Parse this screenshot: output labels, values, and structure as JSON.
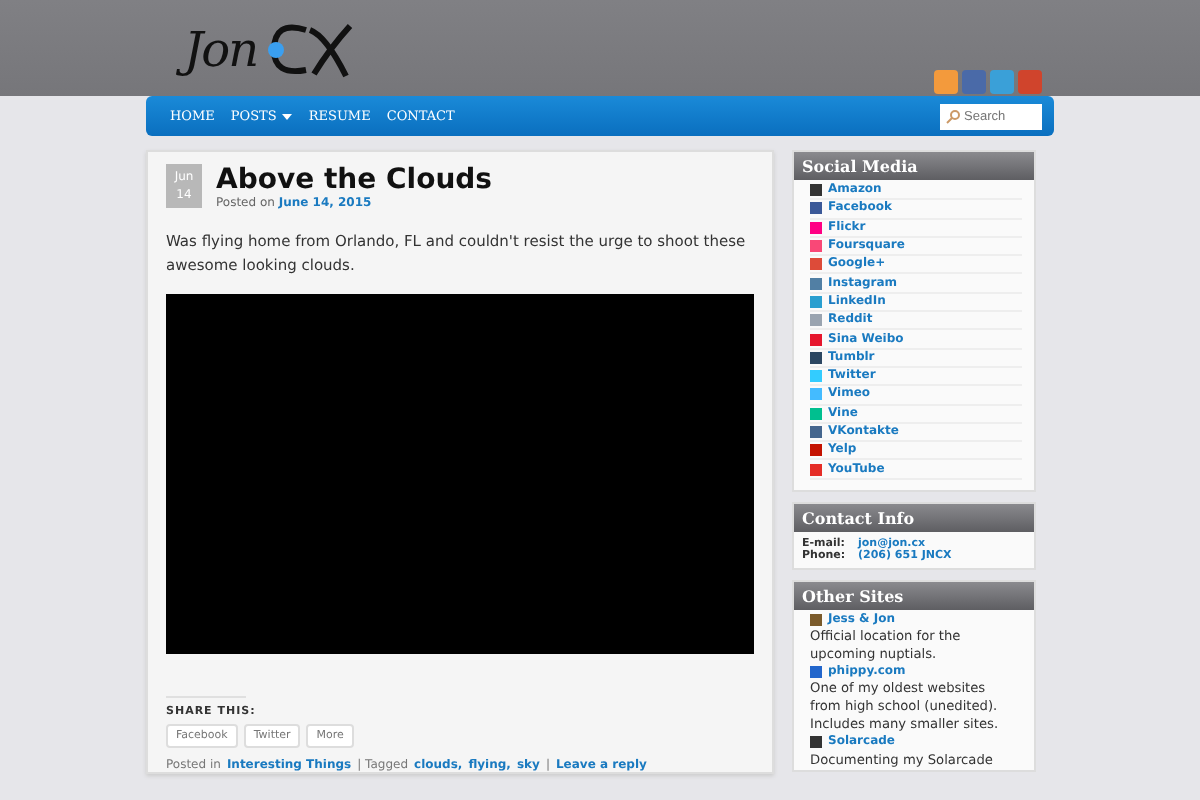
{
  "header": {
    "logo_text": "Jon"
  },
  "nav": {
    "items": [
      {
        "label": "HOME",
        "dropdown": false
      },
      {
        "label": "POSTS",
        "dropdown": true
      },
      {
        "label": "RESUME",
        "dropdown": false
      },
      {
        "label": "CONTACT",
        "dropdown": false
      }
    ],
    "search": {
      "placeholder": "Search"
    }
  },
  "post": {
    "date": {
      "month": "Jun",
      "day": "14"
    },
    "title": "Above the Clouds",
    "posted_on": "Posted on",
    "posted_date": "June 14, 2015",
    "body": "Was flying home from Orlando, FL and couldn't resist the urge to shoot these awesome looking clouds.",
    "share_title": "SHARE THIS:",
    "share_buttons": [
      "Facebook",
      "Twitter",
      "More"
    ],
    "footer": {
      "posted_in": "Posted in",
      "category": "Interesting Things",
      "tagged": "| Tagged",
      "tags": [
        "clouds,",
        "flying,",
        "sky"
      ],
      "sep": "|",
      "reply": "Leave a reply"
    }
  },
  "sidebar": {
    "social": {
      "title": "Social Media",
      "items": [
        {
          "label": "Amazon",
          "color": "#333333"
        },
        {
          "label": "Facebook",
          "color": "#3b5998"
        },
        {
          "label": "Flickr",
          "color": "#ff0084"
        },
        {
          "label": "Foursquare",
          "color": "#f94877"
        },
        {
          "label": "Google+",
          "color": "#dd4b39"
        },
        {
          "label": "Instagram",
          "color": "#517fa4"
        },
        {
          "label": "LinkedIn",
          "color": "#2a9fd0"
        },
        {
          "label": "Reddit",
          "color": "#9aa4b0"
        },
        {
          "label": "Sina Weibo",
          "color": "#e6162d"
        },
        {
          "label": "Tumblr",
          "color": "#2c4762"
        },
        {
          "label": "Twitter",
          "color": "#33ccff"
        },
        {
          "label": "Vimeo",
          "color": "#44bbff"
        },
        {
          "label": "Vine",
          "color": "#00bf8f"
        },
        {
          "label": "VKontakte",
          "color": "#45668e"
        },
        {
          "label": "Yelp",
          "color": "#c41200"
        },
        {
          "label": "YouTube",
          "color": "#e52d27"
        }
      ]
    },
    "contact": {
      "title": "Contact Info",
      "rows": [
        {
          "label": "E-mail:",
          "value": "jon@jon.cx"
        },
        {
          "label": "Phone:",
          "value": "(206) 651 JNCX"
        }
      ]
    },
    "sites": {
      "title": "Other Sites",
      "items": [
        {
          "name": "Jess & Jon",
          "description": "Official location for the upcoming nuptials.",
          "color": "#7a5a2a"
        },
        {
          "name": "phippy.com",
          "description": "One of my oldest websites from high school (unedited). Includes many smaller sites.",
          "color": "#2266cc"
        },
        {
          "name": "Solarcade",
          "description": "Documenting my Solarcade",
          "color": "#333333"
        }
      ]
    }
  }
}
